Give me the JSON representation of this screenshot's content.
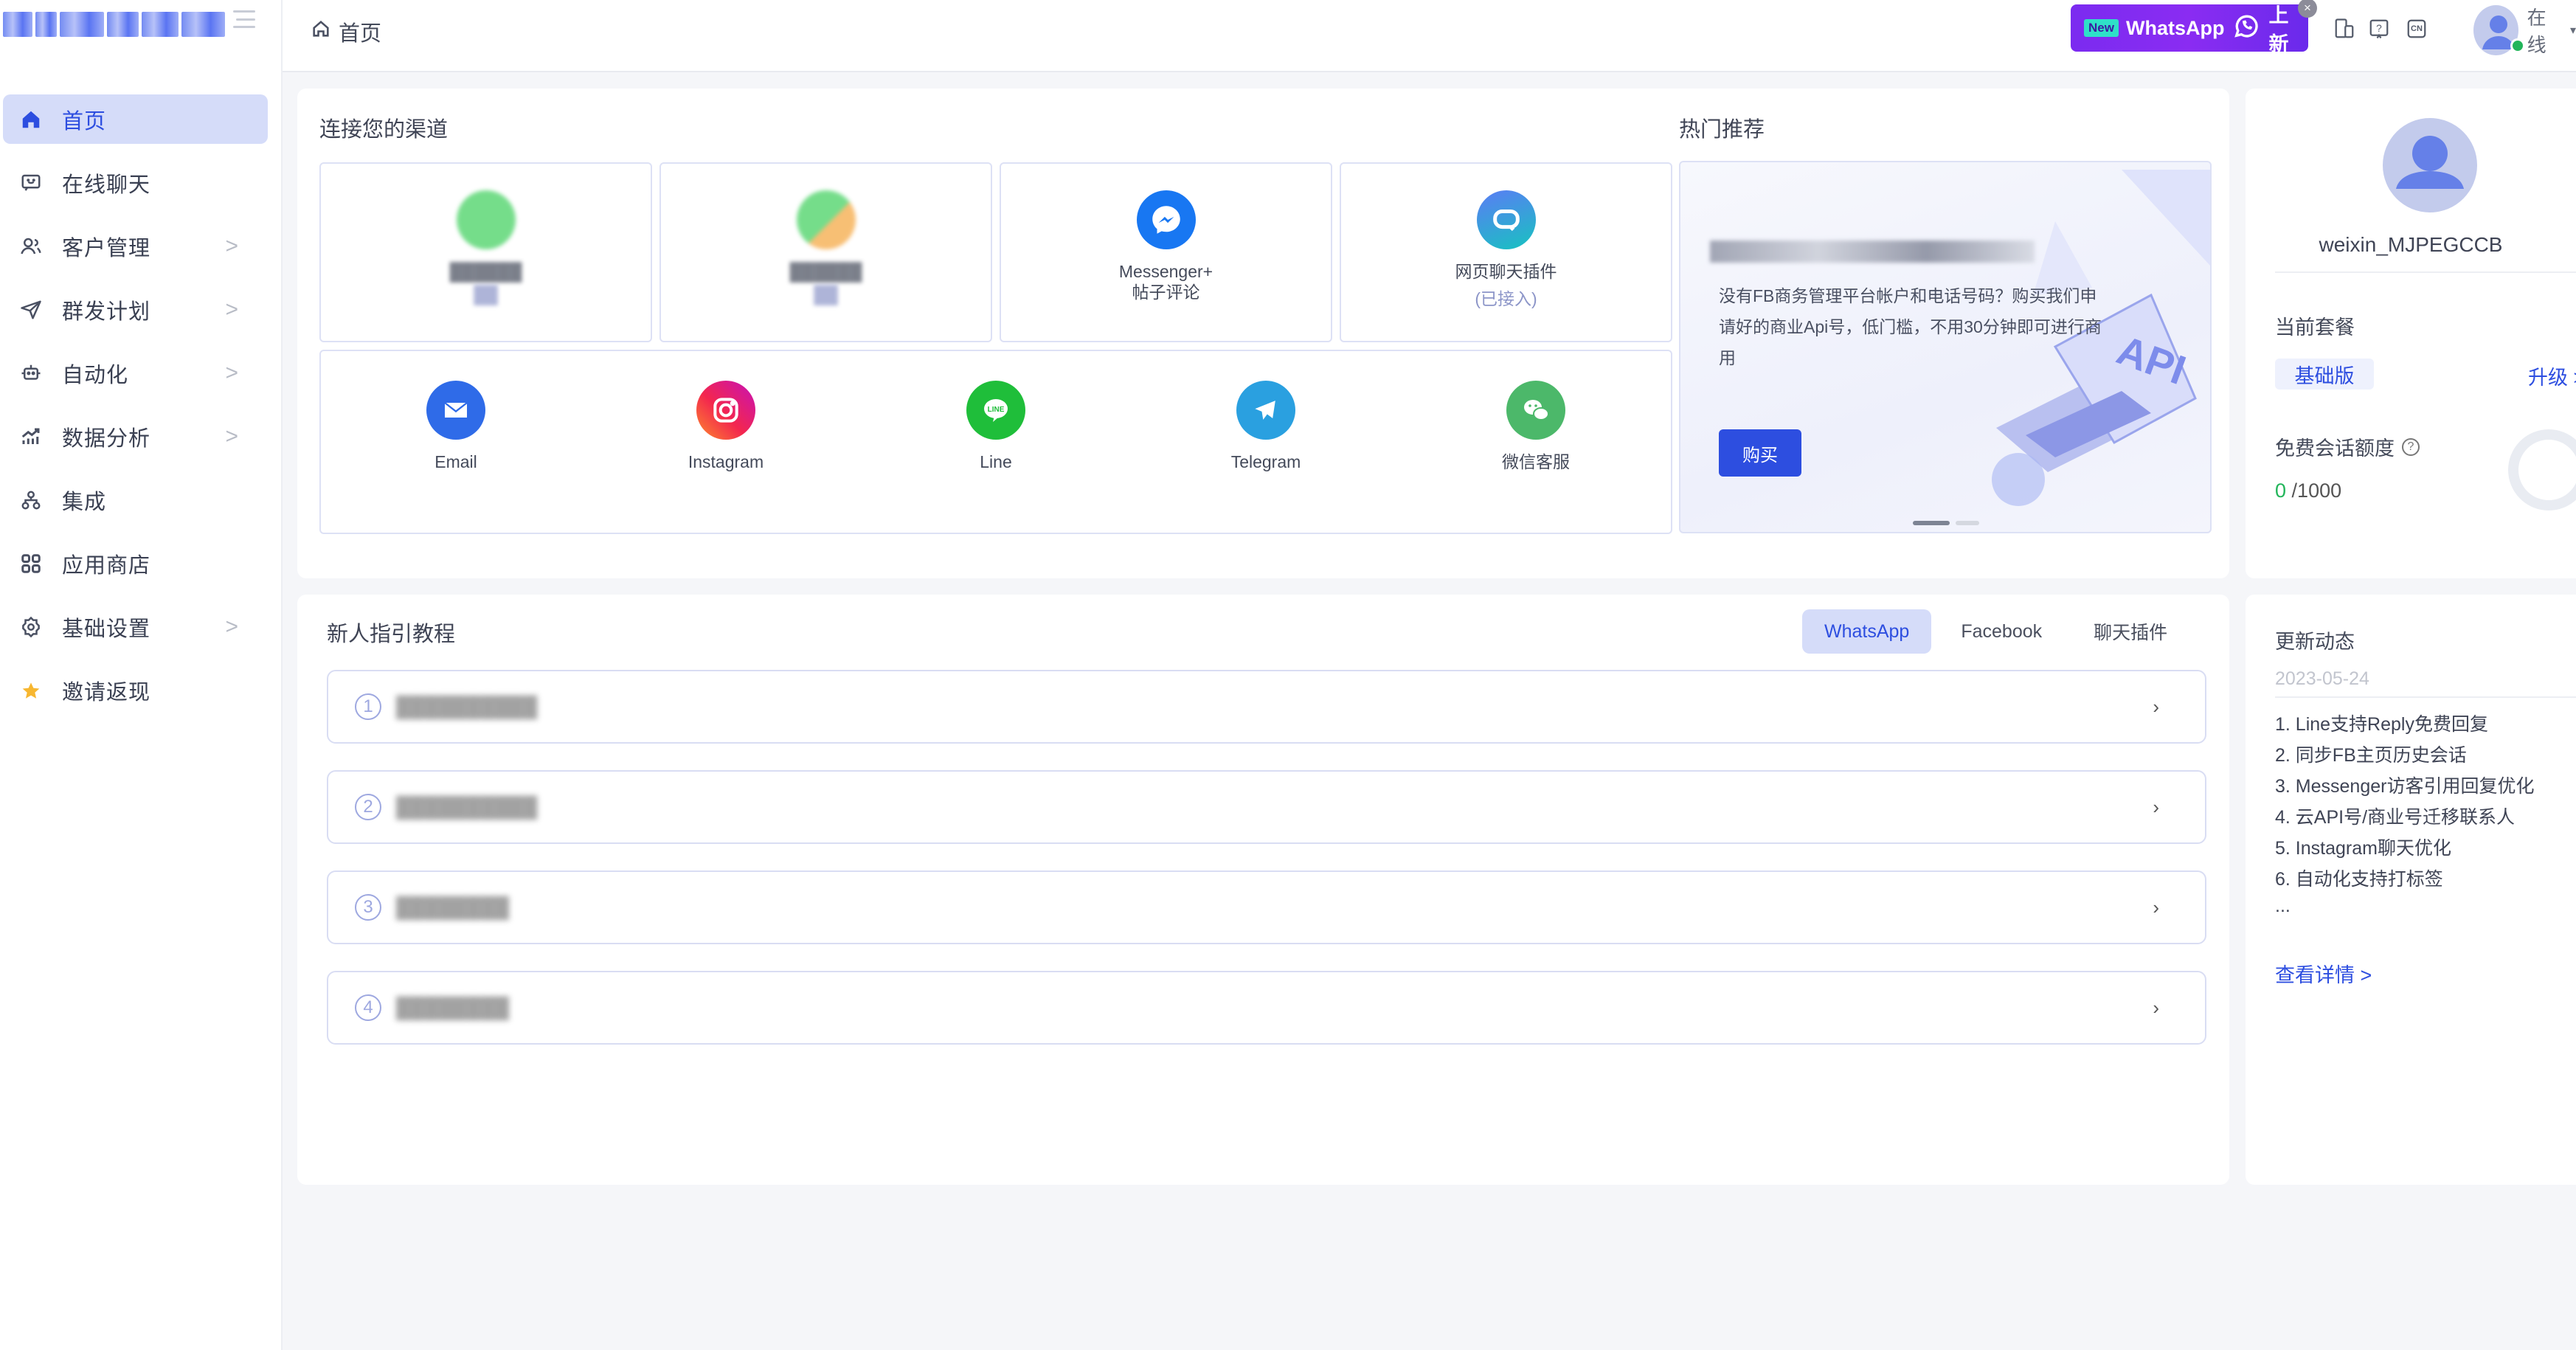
{
  "sidebar": {
    "logo_alt": "pixelated brand logo",
    "items": [
      {
        "label": "首页",
        "icon": "home-icon",
        "active": true,
        "has_children": false
      },
      {
        "label": "在线聊天",
        "icon": "chat-icon",
        "has_children": false
      },
      {
        "label": "客户管理",
        "icon": "users-icon",
        "has_children": true
      },
      {
        "label": "群发计划",
        "icon": "send-icon",
        "has_children": true
      },
      {
        "label": "自动化",
        "icon": "robot-icon",
        "has_children": true
      },
      {
        "label": "数据分析",
        "icon": "chart-icon",
        "has_children": true
      },
      {
        "label": "集成",
        "icon": "integration-icon",
        "has_children": false
      },
      {
        "label": "应用商店",
        "icon": "apps-icon",
        "has_children": false
      },
      {
        "label": "基础设置",
        "icon": "gear-icon",
        "has_children": true
      },
      {
        "label": "邀请返现",
        "icon": "star-icon",
        "has_children": false
      }
    ]
  },
  "topbar": {
    "breadcrumb": "首页",
    "promo": {
      "badge": "New",
      "text": "WhatsApp",
      "suffix": "上新"
    },
    "icons": [
      "device-icon",
      "help-icon",
      "language-icon"
    ],
    "language_code": "CN",
    "status": "在线"
  },
  "channels": {
    "title": "连接您的渠道",
    "row1": [
      {
        "label": "██████",
        "sub": "██",
        "icon": "whatsapp-icon",
        "blurred": true
      },
      {
        "label": "██████",
        "sub": "██",
        "icon": "whatsapp-business-icon",
        "blurred": true
      },
      {
        "label": "Messenger+",
        "sub": "帖子评论",
        "icon": "messenger-icon"
      },
      {
        "label": "网页聊天插件",
        "sub": "(已接入)",
        "icon": "webchat-icon"
      }
    ],
    "row2": [
      {
        "label": "Email",
        "icon": "email-icon",
        "color": "#2f6be8"
      },
      {
        "label": "Instagram",
        "icon": "instagram-icon",
        "color": "#e1306c"
      },
      {
        "label": "Line",
        "icon": "line-icon",
        "color": "#1fbe3a"
      },
      {
        "label": "Telegram",
        "icon": "telegram-icon",
        "color": "#2aa0e0"
      },
      {
        "label": "微信客服",
        "icon": "wechat-icon",
        "color": "#4cb86a"
      }
    ]
  },
  "recommend": {
    "title": "热门推荐",
    "headline": "████████████████████",
    "body": "没有FB商务管理平台帐户和电话号码？购买我们申请好的商业Api号，低门槛，不用30分钟即可进行商用",
    "button": "购买",
    "slides_total": 2,
    "slide_active": 1,
    "illustration_text": "API"
  },
  "profile": {
    "username": "weixin_MJPEGCCB",
    "plan_label": "当前套餐",
    "plan": "基础版",
    "upgrade": "升级",
    "quota_label": "免费会话额度",
    "quota_used": "0",
    "quota_total": "/1000"
  },
  "tutorial": {
    "title": "新人指引教程",
    "tabs": [
      {
        "label": "WhatsApp",
        "active": true
      },
      {
        "label": "Facebook"
      },
      {
        "label": "聊天插件"
      }
    ],
    "steps": [
      {
        "num": "1",
        "text": "██████████"
      },
      {
        "num": "2",
        "text": "██████████"
      },
      {
        "num": "3",
        "text": "████████"
      },
      {
        "num": "4",
        "text": "████████"
      }
    ]
  },
  "updates": {
    "title": "更新动态",
    "date": "2023-05-24",
    "items": [
      "1. Line支持Reply免费回复",
      "2. 同步FB主页历史会话",
      "3. Messenger访客引用回复优化",
      "4. 云API号/商业号迁移联系人",
      "5. Instagram聊天优化",
      "6. 自动化支持打标签",
      "..."
    ],
    "more": "查看详情 >"
  },
  "colors": {
    "accent": "#2d4ee0",
    "active_bg": "#d5dcf9",
    "success": "#22b55a",
    "promo": "#7b2bf0"
  }
}
